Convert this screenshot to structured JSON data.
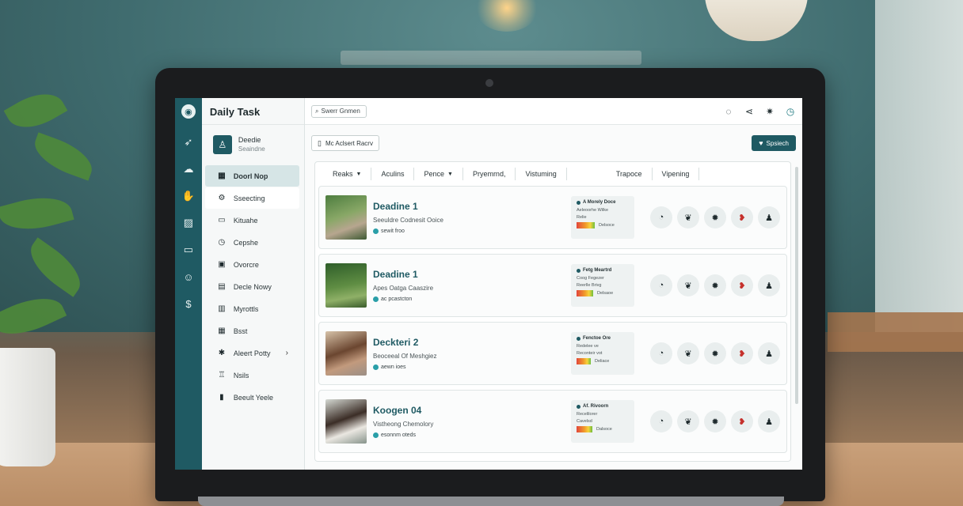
{
  "app": {
    "title": "Daily Task"
  },
  "search": {
    "placeholder": "Swerr Gnmen"
  },
  "profile": {
    "name": "Deedie",
    "sub": "Seaindne"
  },
  "nav": {
    "items": [
      {
        "icon": "grid-icon",
        "glyph": "▦",
        "label": "Doorl Nop",
        "state": "active"
      },
      {
        "icon": "settings-icon",
        "glyph": "⚙",
        "label": "Sseecting",
        "state": "hover"
      },
      {
        "icon": "tv-icon",
        "glyph": "▭",
        "label": "Kituahe",
        "state": ""
      },
      {
        "icon": "clock-icon",
        "glyph": "◷",
        "label": "Cepshe",
        "state": ""
      },
      {
        "icon": "lock-icon",
        "glyph": "▣",
        "label": "Ovorcre",
        "state": ""
      },
      {
        "icon": "folder-icon",
        "glyph": "▤",
        "label": "Decle Nowy",
        "state": ""
      },
      {
        "icon": "chart-icon",
        "glyph": "▥",
        "label": "Myrottls",
        "state": ""
      },
      {
        "icon": "table-icon",
        "glyph": "▦",
        "label": "Bsst",
        "state": ""
      },
      {
        "icon": "star-icon",
        "glyph": "✱",
        "label": "Aleert Potty",
        "state": "",
        "has_chevron": true
      },
      {
        "icon": "bell-icon",
        "glyph": "♖",
        "label": "Nsils",
        "state": ""
      },
      {
        "icon": "doc-icon",
        "glyph": "▮",
        "label": "Beeult Yeele",
        "state": ""
      }
    ]
  },
  "rail": {
    "icons": [
      {
        "name": "logo-icon",
        "glyph": "◉"
      },
      {
        "name": "rocket-icon",
        "glyph": "➶"
      },
      {
        "name": "cloud-icon",
        "glyph": "☁"
      },
      {
        "name": "hand-icon",
        "glyph": "✋"
      },
      {
        "name": "briefcase-icon",
        "glyph": "▨"
      },
      {
        "name": "message-icon",
        "glyph": "▭"
      },
      {
        "name": "smile-icon",
        "glyph": "☺"
      },
      {
        "name": "dollar-icon",
        "glyph": "$"
      }
    ]
  },
  "toolbar": {
    "filter_label": "Mc Aclsert Racrv",
    "primary_label": "Spsiech"
  },
  "table": {
    "headers": [
      {
        "label": "Reaks",
        "has_caret": true
      },
      {
        "label": "Aculins",
        "has_caret": false
      },
      {
        "label": "Pence",
        "has_caret": true
      },
      {
        "label": "Pryemrnd,",
        "has_caret": false
      },
      {
        "label": "Vistuming",
        "has_caret": false
      },
      {
        "label": "Trapoce",
        "has_caret": false
      },
      {
        "label": "Vipening",
        "has_caret": false
      }
    ],
    "rows": [
      {
        "title": "Deadine 1",
        "sub": "Seeuldre Codnesit Ooice",
        "meta": "sewit froo",
        "card_head": "A Morely Doce",
        "card_line1": "Aeleoorhe Wilke",
        "card_line2": "Relie",
        "card_bar_label": "Delsoce",
        "progress": 0.75
      },
      {
        "title": "Deadine 1",
        "sub": "Apes Oatga Caaszire",
        "meta": "ac pcastcton",
        "card_head": "Fetg Meartrd",
        "card_line1": "Coog Fegezer",
        "card_line2": "Reerlle Brivg",
        "card_bar_label": "Delsaoe",
        "progress": 0.7
      },
      {
        "title": "Deckteri 2",
        "sub": "Beoceeal Of Meshgiez",
        "meta": "aewn ioes",
        "card_head": "Fenctoe Ore",
        "card_line1": "Redelee ve",
        "card_line2": "Reconteir vot",
        "card_bar_label": "Deliace",
        "progress": 0.6
      },
      {
        "title": "Koogen 04",
        "sub": "Vistheong Chemolory",
        "meta": "esonnm oteds",
        "card_head": "Af. Rivoorn",
        "card_line1": "Recelilorer",
        "card_line2": "Cavelsd",
        "card_bar_label": "Dalsoce",
        "progress": 0.65
      }
    ],
    "row_actions": [
      {
        "name": "timer-icon",
        "glyph": "◔",
        "accent": false
      },
      {
        "name": "leaf-icon",
        "glyph": "❦",
        "accent": false
      },
      {
        "name": "settings-gear-icon",
        "glyph": "✹",
        "accent": false
      },
      {
        "name": "heart-icon",
        "glyph": "❥",
        "accent": true
      },
      {
        "name": "user-icon",
        "glyph": "♟",
        "accent": false
      }
    ]
  },
  "colors": {
    "primary": "#1f5a63",
    "accent_red": "#c5302b"
  }
}
